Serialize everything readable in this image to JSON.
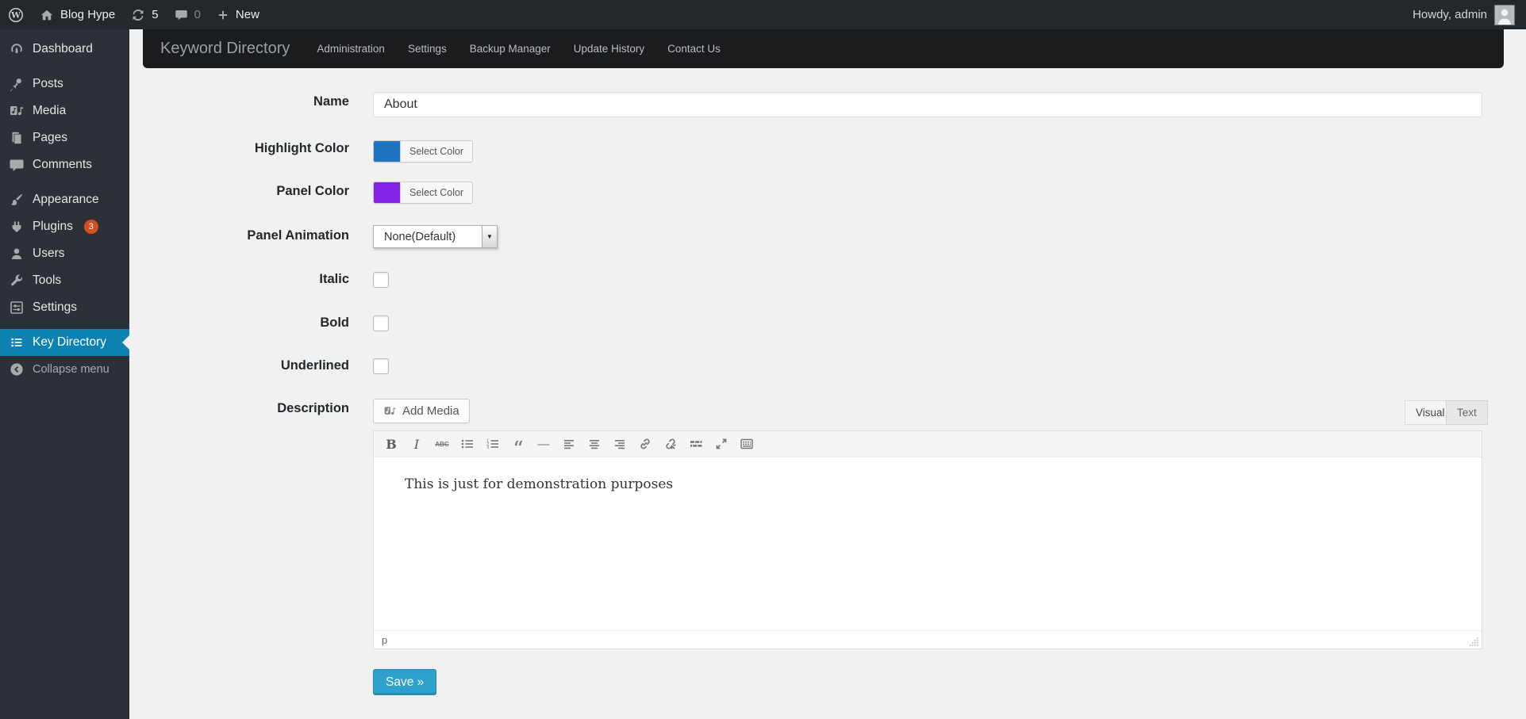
{
  "admin_bar": {
    "site_name": "Blog Hype",
    "update_count": "5",
    "comment_count": "0",
    "new_label": "New",
    "howdy": "Howdy, admin"
  },
  "sidebar": {
    "items": [
      {
        "label": "Dashboard",
        "icon": "dashboard-icon"
      },
      {
        "label": "Posts",
        "icon": "pushpin-icon"
      },
      {
        "label": "Media",
        "icon": "media-icon"
      },
      {
        "label": "Pages",
        "icon": "pages-icon"
      },
      {
        "label": "Comments",
        "icon": "comment-icon"
      },
      {
        "label": "Appearance",
        "icon": "brush-icon"
      },
      {
        "label": "Plugins",
        "icon": "plug-icon",
        "badge": "3"
      },
      {
        "label": "Users",
        "icon": "user-icon"
      },
      {
        "label": "Tools",
        "icon": "wrench-icon"
      },
      {
        "label": "Settings",
        "icon": "sliders-icon"
      },
      {
        "label": "Key Directory",
        "icon": "list-icon",
        "active": true
      },
      {
        "label": "Collapse menu",
        "icon": "collapse-arrow-icon"
      }
    ]
  },
  "plugin_nav": {
    "brand": "Keyword Directory",
    "items": [
      "Administration",
      "Settings",
      "Backup Manager",
      "Update History",
      "Contact Us"
    ]
  },
  "form": {
    "name": {
      "label": "Name",
      "value": "About"
    },
    "highlight_color": {
      "label": "Highlight Color",
      "button_label": "Select Color",
      "swatch": "#1e73be"
    },
    "panel_color": {
      "label": "Panel Color",
      "button_label": "Select Color",
      "swatch": "#8224e3"
    },
    "panel_animation": {
      "label": "Panel Animation",
      "value": "None(Default)"
    },
    "italic": {
      "label": "Italic",
      "checked": false
    },
    "bold": {
      "label": "Bold",
      "checked": false
    },
    "underlined": {
      "label": "Underlined",
      "checked": false
    },
    "description": {
      "label": "Description",
      "add_media_label": "Add Media",
      "tabs": [
        "Visual",
        "Text"
      ],
      "active_tab": "Visual",
      "toolbar_icons": [
        "bold",
        "italic",
        "strikethrough",
        "bullet-list",
        "numbered-list",
        "blockquote",
        "horizontal-rule",
        "align-left",
        "align-center",
        "align-right",
        "link",
        "unlink",
        "more-tag",
        "fullscreen",
        "toolbar-toggle"
      ],
      "content": "This is just for demonstration purposes",
      "status_path": "p"
    },
    "save_label": "Save »"
  },
  "colors": {
    "admin_bar_bg": "#23282d",
    "sidebar_bg": "#2b3137",
    "active_menu_bg": "#0d82b0",
    "plugin_nav_bg": "#1b1c1e",
    "badge_bg": "#d54e21",
    "save_button_bg": "#2ea2cc",
    "highlight_swatch": "#1e73be",
    "panel_swatch": "#8224e3",
    "content_bg": "#f1f1f1"
  }
}
